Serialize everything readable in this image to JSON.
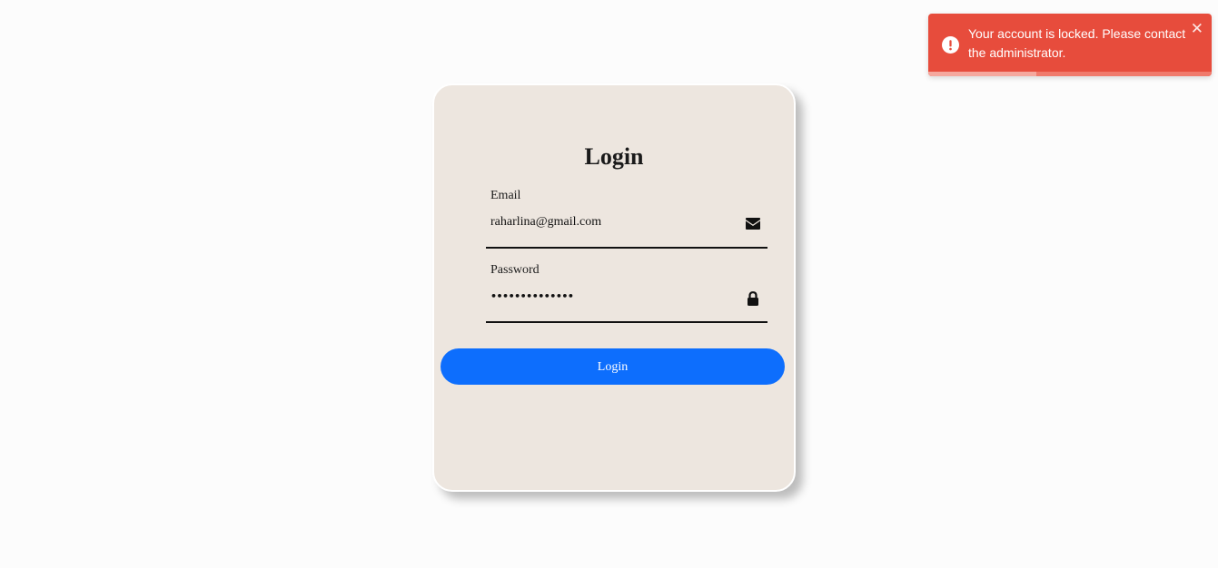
{
  "login": {
    "title": "Login",
    "email_label": "Email",
    "email_value": "raharlina@gmail.com",
    "password_label": "Password",
    "password_value": "••••••••••••••",
    "button_label": "Login",
    "email_icon": "envelope-icon",
    "password_icon": "lock-icon",
    "button_color": "#0d6efd",
    "card_color": "#ede6df"
  },
  "toast": {
    "message": "Your account is locked. Please contact the administrator.",
    "close_label": "✕",
    "icon": "error-circle-icon",
    "color": "#e74c3c",
    "progress_fraction": 0.38
  }
}
